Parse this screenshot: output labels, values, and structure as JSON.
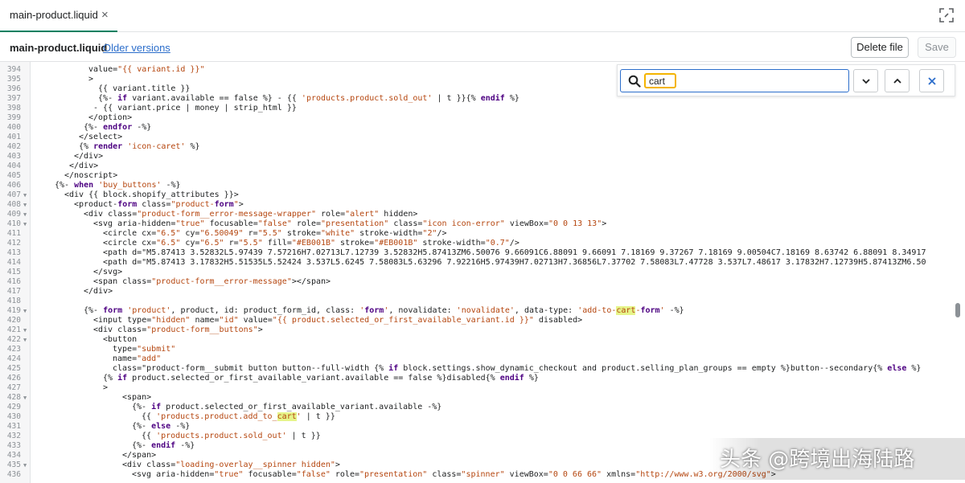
{
  "tab": {
    "name": "main-product.liquid",
    "close_glyph": "×"
  },
  "header": {
    "file_name": "main-product.liquid",
    "older_versions": "Older versions",
    "delete_label": "Delete file",
    "save_label": "Save"
  },
  "find": {
    "query": "cart"
  },
  "watermark": "头条 @跨境出海陆路",
  "colors": {
    "accent": "#008060",
    "link": "#2c6ecb",
    "search_highlight": "#f4b400",
    "liquid_tag": "#4d0082",
    "string": "#b5460f",
    "html_tag": "#990000"
  },
  "code_lines": [
    {
      "n": "394",
      "indent": 110,
      "text": "value=\"{{ variant.id }}\""
    },
    {
      "n": "395",
      "indent": 110,
      "text": ">"
    },
    {
      "n": "396",
      "indent": 110,
      "text": "  {{ variant.title }}"
    },
    {
      "n": "397",
      "indent": 110,
      "text": "  {%- if variant.available == false %} - {{ 'products.product.sold_out' | t }}{% endif %}"
    },
    {
      "n": "398",
      "indent": 110,
      "text": " - {{ variant.price | money | strip_html }}"
    },
    {
      "n": "399",
      "indent": 110,
      "text": "</option>"
    },
    {
      "n": "400",
      "indent": 104,
      "text": "{%- endfor -%}"
    },
    {
      "n": "401",
      "indent": 98,
      "text": "</select>"
    },
    {
      "n": "402",
      "indent": 98,
      "text": "{% render 'icon-caret' %}"
    },
    {
      "n": "403",
      "indent": 92,
      "text": "</div>"
    },
    {
      "n": "404",
      "indent": 86,
      "text": "</div>"
    },
    {
      "n": "405",
      "indent": 80,
      "text": "</noscript>"
    },
    {
      "n": "406",
      "indent": 68,
      "text": "{%- when 'buy_buttons' -%}"
    },
    {
      "n": "407",
      "indent": 80,
      "text": "<div {{ block.shopify_attributes }}>"
    },
    {
      "n": "408",
      "indent": 92,
      "text": "<product-form class=\"product-form\">"
    },
    {
      "n": "409",
      "indent": 104,
      "text": "<div class=\"product-form__error-message-wrapper\" role=\"alert\" hidden>"
    },
    {
      "n": "410",
      "indent": 116,
      "text": "<svg aria-hidden=\"true\" focusable=\"false\" role=\"presentation\" class=\"icon icon-error\" viewBox=\"0 0 13 13\">"
    },
    {
      "n": "411",
      "indent": 128,
      "text": "<circle cx=\"6.5\" cy=\"6.50049\" r=\"5.5\" stroke=\"white\" stroke-width=\"2\"/>"
    },
    {
      "n": "412",
      "indent": 128,
      "text": "<circle cx=\"6.5\" cy=\"6.5\" r=\"5.5\" fill=\"#EB001B\" stroke=\"#EB001B\" stroke-width=\"0.7\"/>"
    },
    {
      "n": "413",
      "indent": 128,
      "text": "<path d=\"M5.87413 3.52832L5.97439 7.57216H7.02713L7.12739 3.52832H5.87413ZM6.50076 9.66091C6.88091 9.66091 7.18169 9.37267 7.18169 9.00504C7.18169 8.63742 6.88091 8.34917"
    },
    {
      "n": "414",
      "indent": 128,
      "text": "<path d=\"M5.87413 3.17832H5.51535L5.52424 3.537L5.6245 7.58083L5.63296 7.92216H5.97439H7.02713H7.36856L7.37702 7.58083L7.47728 3.537L7.48617 3.17832H7.12739H5.87413ZM6.50"
    },
    {
      "n": "415",
      "indent": 116,
      "text": "</svg>"
    },
    {
      "n": "416",
      "indent": 116,
      "text": "<span class=\"product-form__error-message\"></span>"
    },
    {
      "n": "417",
      "indent": 104,
      "text": "</div>"
    },
    {
      "n": "418",
      "indent": 104,
      "text": ""
    },
    {
      "n": "419",
      "indent": 104,
      "text": "{%- form 'product', product, id: product_form_id, class: 'form', novalidate: 'novalidate', data-type: 'add-to-cart-form' -%}"
    },
    {
      "n": "420",
      "indent": 116,
      "text": "<input type=\"hidden\" name=\"id\" value=\"{{ product.selected_or_first_available_variant.id }}\" disabled>"
    },
    {
      "n": "421",
      "indent": 116,
      "text": "<div class=\"product-form__buttons\">"
    },
    {
      "n": "422",
      "indent": 128,
      "text": "<button"
    },
    {
      "n": "423",
      "indent": 140,
      "text": "type=\"submit\""
    },
    {
      "n": "424",
      "indent": 140,
      "text": "name=\"add\""
    },
    {
      "n": "425",
      "indent": 140,
      "text": "class=\"product-form__submit button button--full-width {% if block.settings.show_dynamic_checkout and product.selling_plan_groups == empty %}button--secondary{% else %}"
    },
    {
      "n": "426",
      "indent": 128,
      "text": "{% if product.selected_or_first_available_variant.available == false %}disabled{% endif %}"
    },
    {
      "n": "427",
      "indent": 128,
      "text": ">"
    },
    {
      "n": "428",
      "indent": 152,
      "text": "<span>"
    },
    {
      "n": "429",
      "indent": 164,
      "text": "{%- if product.selected_or_first_available_variant.available -%}"
    },
    {
      "n": "430",
      "indent": 176,
      "text": "{{ 'products.product.add_to_cart' | t }}"
    },
    {
      "n": "431",
      "indent": 164,
      "text": "{%- else -%}"
    },
    {
      "n": "432",
      "indent": 176,
      "text": "{{ 'products.product.sold_out' | t }}"
    },
    {
      "n": "433",
      "indent": 164,
      "text": "{%- endif -%}"
    },
    {
      "n": "434",
      "indent": 152,
      "text": "</span>"
    },
    {
      "n": "435",
      "indent": 152,
      "text": "<div class=\"loading-overlay__spinner hidden\">"
    },
    {
      "n": "436",
      "indent": 164,
      "text": "<svg aria-hidden=\"true\" focusable=\"false\" role=\"presentation\" class=\"spinner\" viewBox=\"0 0 66 66\" xmlns=\"http://www.w3.org/2000/svg\">"
    }
  ]
}
